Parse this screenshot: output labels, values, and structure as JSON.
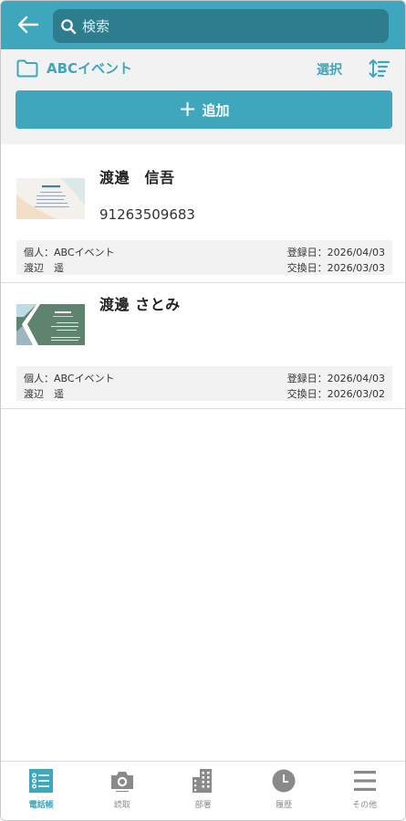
{
  "colors": {
    "accent": "#3ea7bd",
    "search_bg": "#2d7d8e",
    "inactive": "#8a8a8a"
  },
  "search": {
    "placeholder": "検索"
  },
  "folder": {
    "title": "ABCイベント",
    "icon": "folder-icon"
  },
  "actions": {
    "select_label": "選択",
    "sort_icon": "sort-icon",
    "add_label": "追加"
  },
  "cards": [
    {
      "name": "渡邉　信吾",
      "phone": "91263509683",
      "owner_line": "個人：ABCイベント",
      "person_line": "渡辺　遥",
      "registered": "登録日：2026/04/03",
      "exchanged": "交換日：2026/03/03"
    },
    {
      "name": "渡邊 さとみ",
      "phone": "",
      "owner_line": "個人：ABCイベント",
      "person_line": "渡辺　遥",
      "registered": "登録日：2026/04/03",
      "exchanged": "交換日：2026/03/02"
    }
  ],
  "nav": [
    {
      "label": "電話帳",
      "icon": "phonebook-icon",
      "active": true
    },
    {
      "label": "読取",
      "icon": "camera-icon",
      "active": false
    },
    {
      "label": "部署",
      "icon": "building-icon",
      "active": false
    },
    {
      "label": "履歴",
      "icon": "clock-icon",
      "active": false
    },
    {
      "label": "その他",
      "icon": "menu-icon",
      "active": false
    }
  ]
}
